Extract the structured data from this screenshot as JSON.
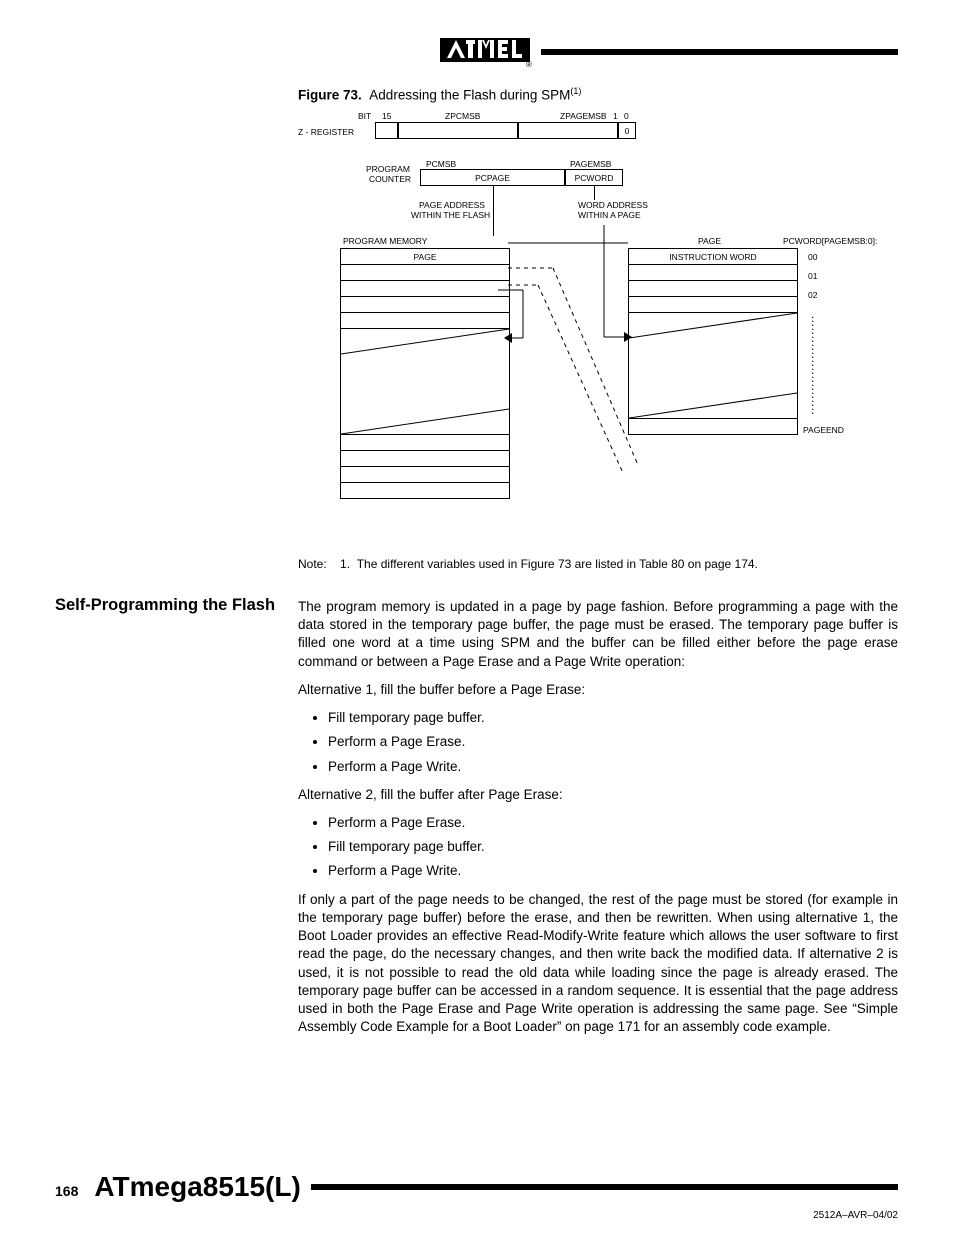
{
  "figure": {
    "caption_label": "Figure 73.",
    "caption_text": "Addressing the Flash during SPM",
    "caption_sup": "(1)",
    "labels": {
      "bit": "BIT",
      "bit15": "15",
      "zpcmsb": "ZPCMSB",
      "zpagemsb": "ZPAGEMSB",
      "bit1": "1",
      "bit0": "0",
      "zreg": "Z - REGISTER",
      "cell0": "0",
      "program": "PROGRAM",
      "counter": "COUNTER",
      "pcmsb": "PCMSB",
      "pagemsb": "PAGEMSB",
      "pcpage": "PCPAGE",
      "pcword": "PCWORD",
      "page_addr1": "PAGE ADDRESS",
      "page_addr2": "WITHIN THE FLASH",
      "word_addr1": "WORD ADDRESS",
      "word_addr2": "WITHIN A PAGE",
      "program_memory": "PROGRAM MEMORY",
      "page_header": "PAGE",
      "page_right": "PAGE",
      "pcword_bits": "PCWORD[PAGEMSB:0]:",
      "instruction_word": "INSTRUCTION WORD",
      "v00": "00",
      "v01": "01",
      "v02": "02",
      "pageend": "PAGEEND"
    }
  },
  "note": {
    "label": "Note:",
    "num": "1.",
    "text": "The different variables used in Figure 73 are listed in Table 80 on page 174."
  },
  "section": {
    "heading": "Self-Programming the Flash",
    "p1": "The program memory is updated in a page by page fashion. Before programming a page with the data stored in the temporary page buffer, the page must be erased. The temporary page buffer is filled one word at a time using SPM and the buffer can be filled either before the page erase command or between a Page Erase and a Page Write operation:",
    "alt1": "Alternative 1, fill the buffer before a Page Erase:",
    "alt1_items": [
      "Fill temporary page buffer.",
      "Perform a Page Erase.",
      "Perform a Page Write."
    ],
    "alt2": "Alternative 2, fill the buffer after Page Erase:",
    "alt2_items": [
      "Perform a Page Erase.",
      "Fill temporary page buffer.",
      "Perform a Page Write."
    ],
    "p2": "If only a part of the page needs to be changed, the rest of the page must be stored (for example in the temporary page buffer) before the erase, and then be rewritten. When using alternative 1, the Boot Loader provides an effective Read-Modify-Write feature which allows the user software to first read the page, do the necessary changes, and then write back the modified data. If alternative 2 is used, it is not possible to read the old data while loading since the page is already erased. The temporary page buffer can be accessed in a random sequence. It is essential that the page address used in both the Page Erase and Page Write operation is addressing the same page. See “Simple Assembly Code Example for a Boot Loader” on page 171 for an assembly code example."
  },
  "footer": {
    "page": "168",
    "title": "ATmega8515(L)",
    "docid": "2512A–AVR–04/02"
  }
}
